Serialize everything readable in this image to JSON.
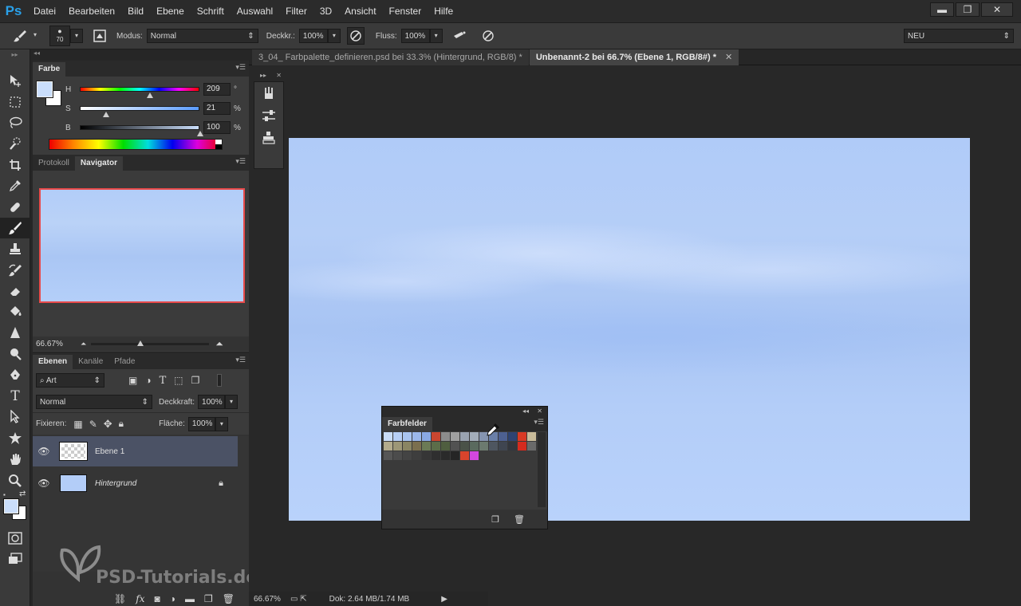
{
  "app": {
    "logo": "Ps",
    "menu": [
      "Datei",
      "Bearbeiten",
      "Bild",
      "Ebene",
      "Schrift",
      "Auswahl",
      "Filter",
      "3D",
      "Ansicht",
      "Fenster",
      "Hilfe"
    ],
    "window_controls": [
      "▬",
      "❐",
      "✕"
    ]
  },
  "options_bar": {
    "brush_size": "70",
    "mode_label": "Modus:",
    "mode_value": "Normal",
    "opacity_label": "Deckkr.:",
    "opacity_value": "100%",
    "flow_label": "Fluss:",
    "flow_value": "100%",
    "workspace_value": "NEU"
  },
  "color_panel": {
    "tab": "Farbe",
    "h_label": "H",
    "h_value": "209",
    "h_unit": "°",
    "h_fraction": 0.58,
    "s_label": "S",
    "s_value": "21",
    "s_unit": "%",
    "s_fraction": 0.21,
    "b_label": "B",
    "b_value": "100",
    "b_unit": "%",
    "b_fraction": 1.0,
    "foreground": "#cadefb",
    "background": "#ffffff"
  },
  "navigator_panel": {
    "tabs": [
      "Protokoll",
      "Navigator"
    ],
    "active_tab": "Navigator",
    "zoom": "66.67%"
  },
  "layers_panel": {
    "tabs": [
      "Ebenen",
      "Kanäle",
      "Pfade"
    ],
    "active_tab": "Ebenen",
    "filter_kind": "Art",
    "blend_mode": "Normal",
    "opacity_label": "Deckkraft:",
    "opacity_value": "100%",
    "lock_label": "Fixieren:",
    "fill_label": "Fläche:",
    "fill_value": "100%",
    "layers": [
      {
        "name": "Ebene 1",
        "selected": true,
        "italic": false,
        "locked": false
      },
      {
        "name": "Hintergrund",
        "selected": false,
        "italic": true,
        "locked": true
      }
    ]
  },
  "documents": {
    "tabs": [
      {
        "label": "3_04_ Farbpalette_definieren.psd bei 33.3% (Hintergrund, RGB/8) *",
        "active": false
      },
      {
        "label": "Unbenannt-2 bei 66.7% (Ebene 1, RGB/8#) *",
        "active": true
      }
    ],
    "canvas_color": "#b3cdf8"
  },
  "swatches_panel": {
    "tab": "Farbfelder",
    "colors": [
      "#c9dcf7",
      "#b7cff5",
      "#a9c4f0",
      "#9bb7ea",
      "#8aa9e3",
      "#c94630",
      "#8c8c8c",
      "#a0a0a0",
      "#9aa3b0",
      "#a3adb9",
      "#8594b0",
      "#6a7fa8",
      "#4d6090",
      "#2e4372",
      "#d83a24",
      "#c9bb9a",
      "#b3ab8c",
      "#9d9777",
      "#8a8563",
      "#7b6f4e",
      "#6b7a55",
      "#5c6d49",
      "#4f5e3f",
      "#525252",
      "#4a5248",
      "#5a6a5e",
      "#6c7a6f",
      "#4e5660",
      "#3f4550",
      "#32363d",
      "#d52b1e",
      "#6a6a6a",
      "#565656",
      "#4c4c4c",
      "#444444",
      "#3e3e3e",
      "#363636",
      "#2f2f2f",
      "#2a2a2a",
      "#252525",
      "#d9442c",
      "#d247e0"
    ]
  },
  "status": {
    "zoom": "66.67%",
    "doc_size": "Dok: 2.64 MB/1.74 MB"
  },
  "watermark": {
    "text": "PSD-Tutorials.de"
  }
}
